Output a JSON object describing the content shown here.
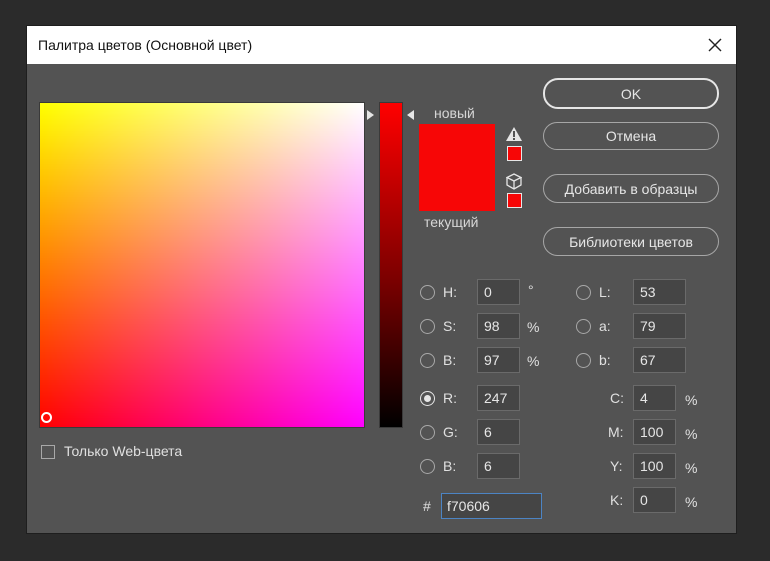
{
  "window": {
    "title": "Палитра цветов (Основной цвет)"
  },
  "preview": {
    "new_label": "новый",
    "current_label": "текущий",
    "new_color": "#f70606",
    "current_color": "#f70606"
  },
  "buttons": {
    "ok": "OK",
    "cancel": "Отмена",
    "add_to_swatches": "Добавить в образцы",
    "color_libraries": "Библиотеки цветов"
  },
  "hsb": {
    "h": {
      "label": "H:",
      "value": "0",
      "unit": "°"
    },
    "s": {
      "label": "S:",
      "value": "98",
      "unit": "%"
    },
    "b": {
      "label": "B:",
      "value": "97",
      "unit": "%"
    }
  },
  "rgb": {
    "r": {
      "label": "R:",
      "value": "247"
    },
    "g": {
      "label": "G:",
      "value": "6"
    },
    "b": {
      "label": "B:",
      "value": "6"
    }
  },
  "lab": {
    "l": {
      "label": "L:",
      "value": "53"
    },
    "a": {
      "label": "a:",
      "value": "79"
    },
    "b": {
      "label": "b:",
      "value": "67"
    }
  },
  "cmyk": {
    "c": {
      "label": "C:",
      "value": "4",
      "unit": "%"
    },
    "m": {
      "label": "M:",
      "value": "100",
      "unit": "%"
    },
    "y": {
      "label": "Y:",
      "value": "100",
      "unit": "%"
    },
    "k": {
      "label": "K:",
      "value": "0",
      "unit": "%"
    }
  },
  "hex": {
    "symbol": "#",
    "value": "f70606"
  },
  "web_only": {
    "label": "Только Web-цвета",
    "checked": false
  },
  "selected_channel": "R",
  "icons": {
    "close": "close-icon",
    "gamut_warning": "warning-triangle-icon",
    "web_safe": "cube-icon"
  }
}
